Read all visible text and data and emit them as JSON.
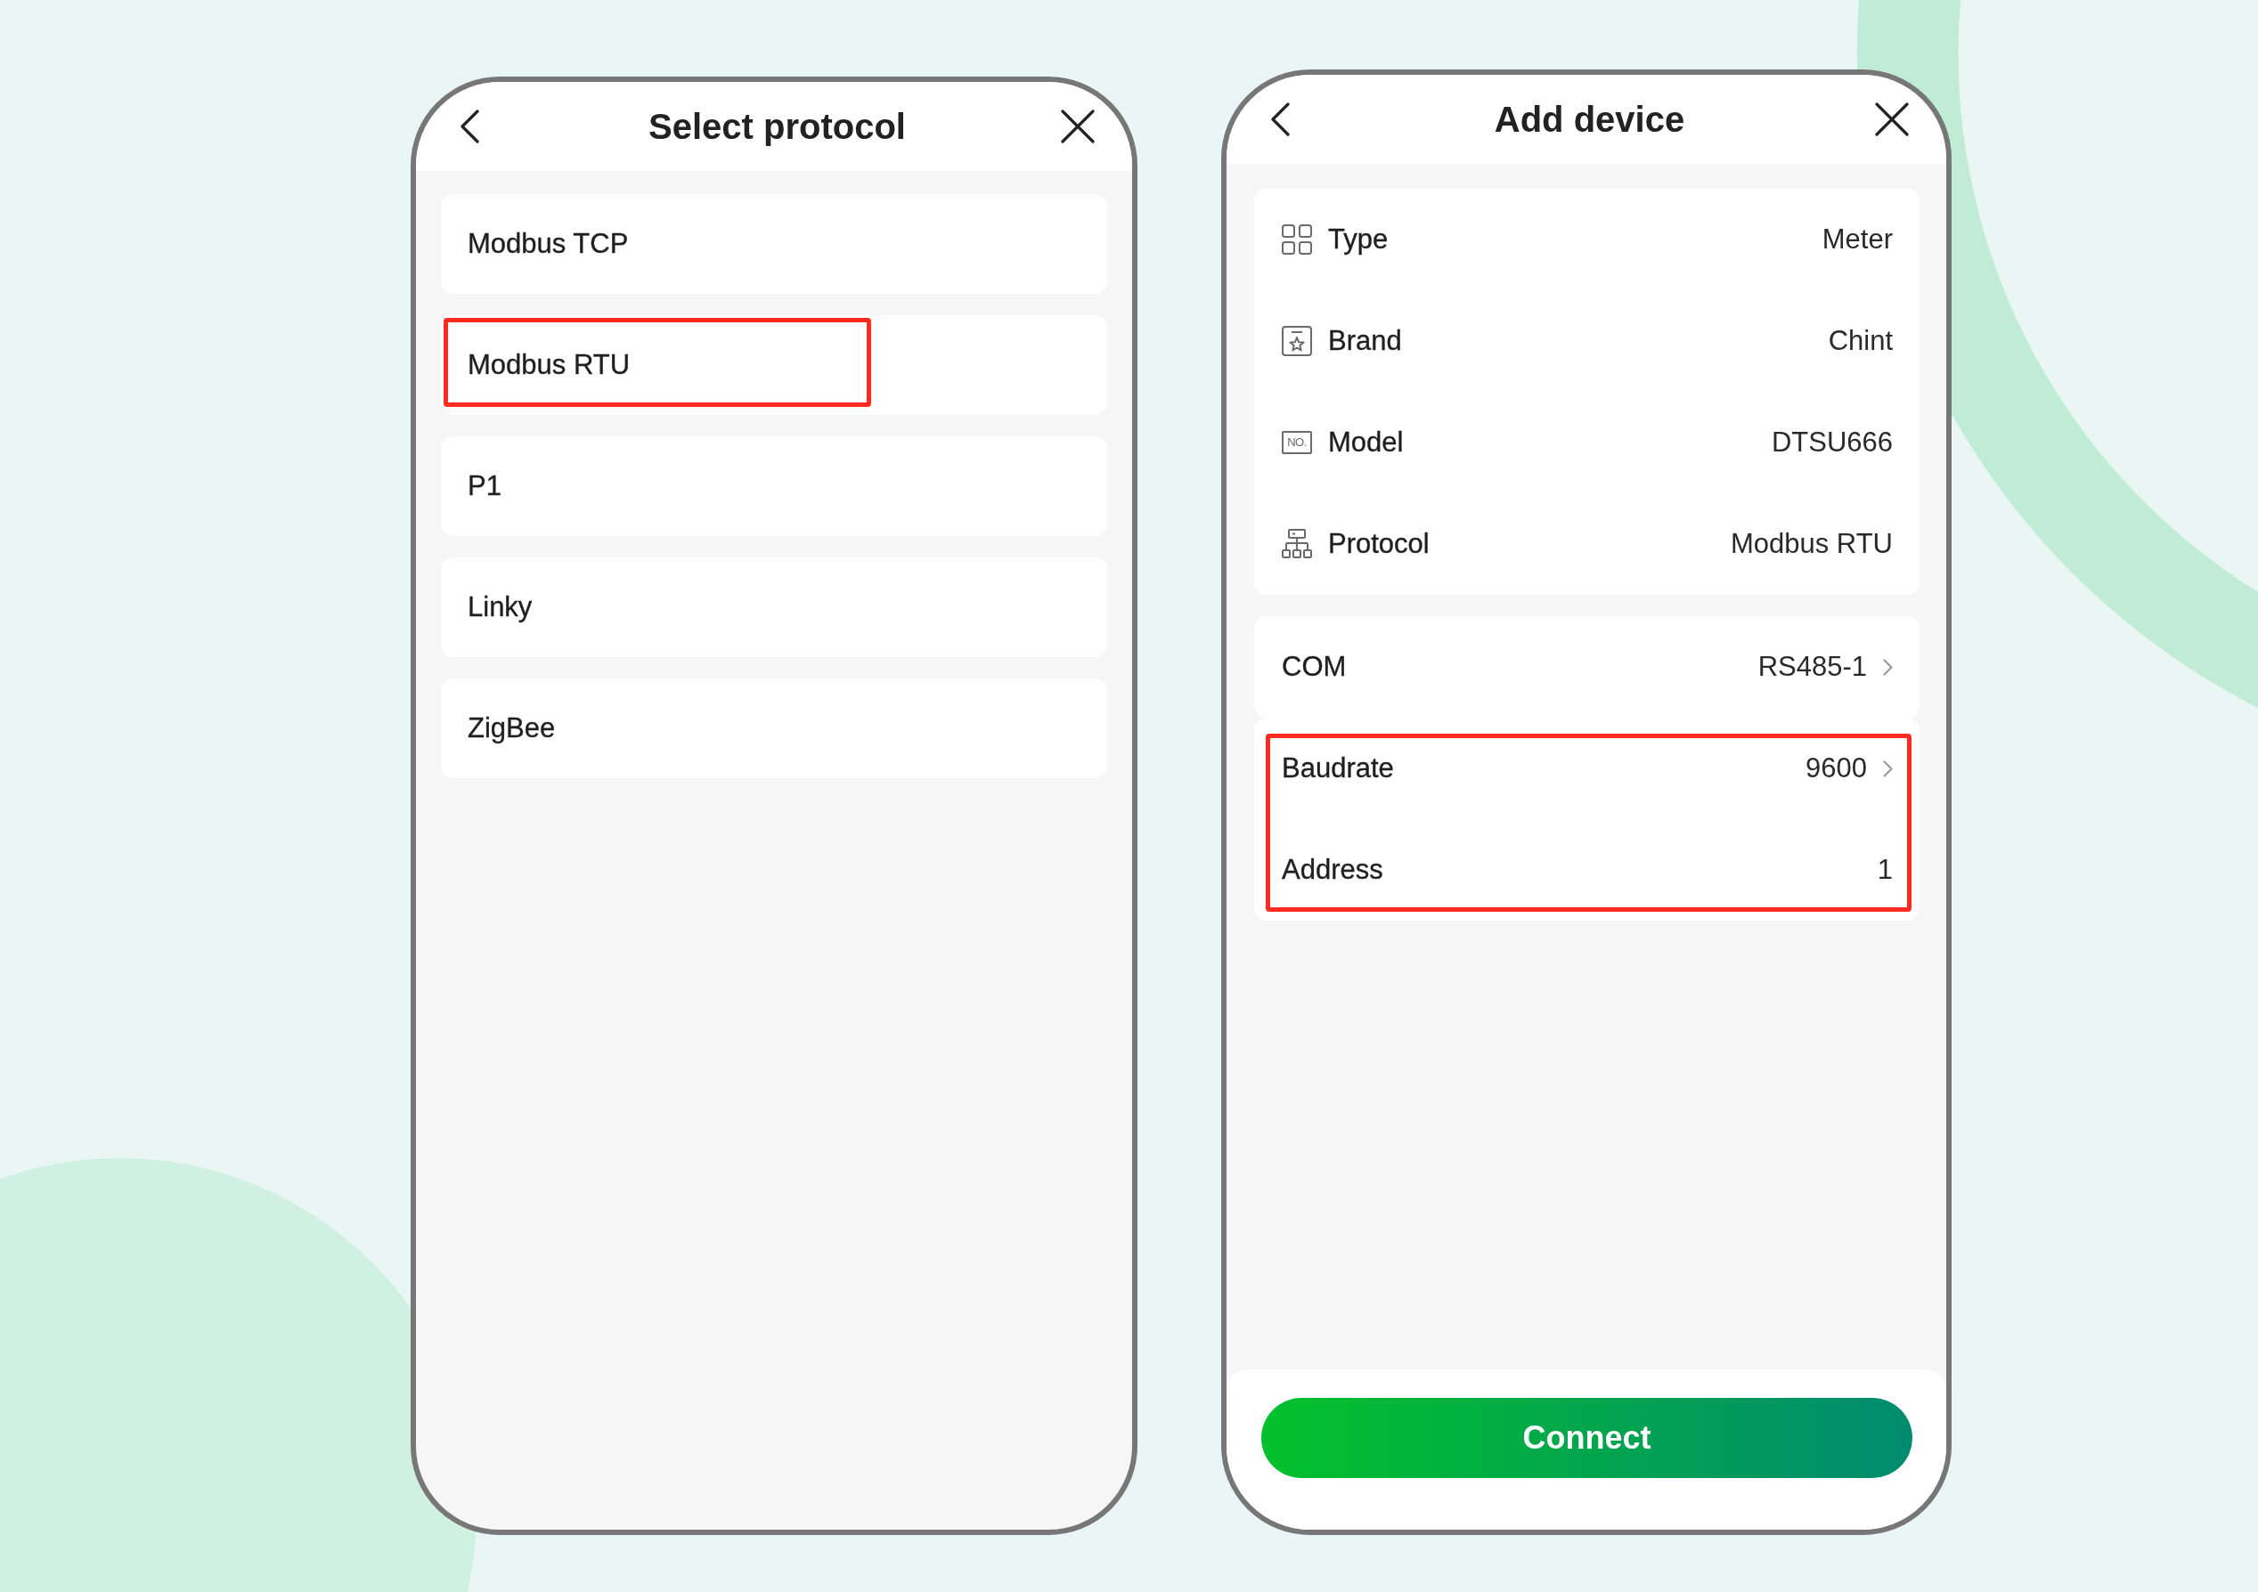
{
  "screens": [
    {
      "kind": "list",
      "title": "Select protocol",
      "items": [
        {
          "label": "Modbus TCP",
          "highlighted": false
        },
        {
          "label": "Modbus RTU",
          "highlighted": true
        },
        {
          "label": "P1",
          "highlighted": false
        },
        {
          "label": "Linky",
          "highlighted": false
        },
        {
          "label": "ZigBee",
          "highlighted": false
        }
      ]
    },
    {
      "kind": "form",
      "title": "Add device",
      "sections": [
        {
          "cards": [
            {
              "highlighted": false,
              "rows": [
                {
                  "kind": "category",
                  "label": "Type",
                  "value": "Meter"
                },
                {
                  "kind": "brand",
                  "label": "Brand",
                  "value": "Chint"
                },
                {
                  "kind": "model",
                  "label": "Model",
                  "value": "DTSU666",
                  "icon_text": "NO."
                },
                {
                  "kind": "protocol",
                  "label": "Protocol",
                  "value": "Modbus RTU"
                }
              ]
            }
          ]
        },
        {
          "cards": [
            {
              "highlighted": false,
              "rows": [
                {
                  "kind": "picker",
                  "label": "COM",
                  "value": "RS485-1"
                }
              ]
            },
            {
              "highlighted": true,
              "rows": [
                {
                  "kind": "picker",
                  "label": "Baudrate",
                  "value": "9600"
                },
                {
                  "kind": "input",
                  "label": "Address",
                  "value": "1"
                }
              ]
            }
          ]
        }
      ],
      "button": "Connect"
    }
  ]
}
